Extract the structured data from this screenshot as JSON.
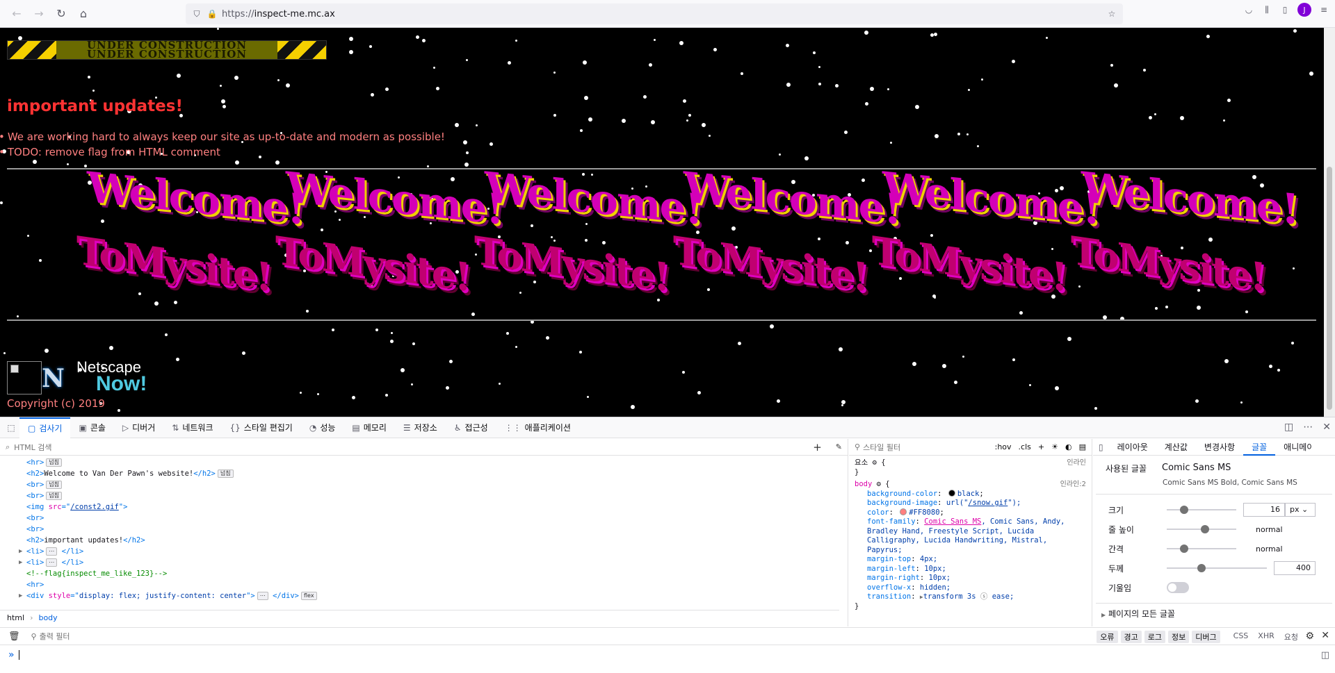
{
  "browser": {
    "url_protocol": "https://",
    "url_host": "inspect-me.mc.ax",
    "avatar_letter": "J"
  },
  "page": {
    "banner_text_1": "UNDER CONSTRUCTION",
    "banner_text_2": "UNDER CONSTRUCTION",
    "heading": "important updates!",
    "updates": [
      "We are working hard to always keep our site as up-to-date and modern as possible!",
      "TODO: remove flag from HTML comment"
    ],
    "welcome_text": "Welcome!",
    "tomysite_text": "ToMysite!",
    "netscape_n": "N",
    "netscape_word1": "Netscape",
    "netscape_word2": "Now!",
    "copyright": "Copyright (c) 2019"
  },
  "devtools": {
    "tabs": [
      {
        "label": "검사기",
        "icon": "inspector-icon"
      },
      {
        "label": "콘솔",
        "icon": "console-icon"
      },
      {
        "label": "디버거",
        "icon": "debugger-icon"
      },
      {
        "label": "네트워크",
        "icon": "network-icon"
      },
      {
        "label": "스타일 편집기",
        "icon": "style-editor-icon"
      },
      {
        "label": "성능",
        "icon": "performance-icon"
      },
      {
        "label": "메모리",
        "icon": "memory-icon"
      },
      {
        "label": "저장소",
        "icon": "storage-icon"
      },
      {
        "label": "접근성",
        "icon": "accessibility-icon"
      },
      {
        "label": "애플리케이션",
        "icon": "application-icon"
      }
    ],
    "html_search_placeholder": "HTML 검색",
    "html_lines": {
      "l1_tag": "<hr>",
      "l1_badge": "넘침",
      "l2_open": "<h2>",
      "l2_text": "Welcome to Van Der Pawn's website!",
      "l2_close": "</h2>",
      "l2_badge": "넘침",
      "l3_tag": "<br>",
      "l3_badge": "넘침",
      "l4_tag": "<br>",
      "l4_badge": "넘침",
      "l5_pre": "<img ",
      "l5_attr": "src",
      "l5_eq": "=\"",
      "l5_val": "/const2.gif",
      "l5_post": "\">",
      "l6_tag": "<br>",
      "l7_tag": "<br>",
      "l8_open": "<h2>",
      "l8_text": "important updates!",
      "l8_close": "</h2>",
      "l9_open": "<li>",
      "l9_dots": "⋯",
      "l9_close": "</li>",
      "l10_open": "<li>",
      "l10_dots": "⋯",
      "l10_close": "</li>",
      "l11_comment": "<!--flag{inspect_me_like_123}-->",
      "l12_tag": "<hr>",
      "l13_pre": "<div ",
      "l13_attr": "style",
      "l13_eq": "=\"",
      "l13_val": "display: flex; justify-content: center",
      "l13_post": "\">",
      "l13_dots": "⋯",
      "l13_close": "</div>",
      "l13_badge": "flex"
    },
    "breadcrumb": [
      "html",
      "body"
    ],
    "rules": {
      "filter_placeholder": "스타일 필터",
      "hov": ":hov",
      "cls": ".cls",
      "element_selector": "요소",
      "inline_label": "인라인",
      "body_selector": "body",
      "body_source": "인라인:2",
      "declarations": [
        {
          "prop": "background-color",
          "val": "black",
          "swatch": "#000000"
        },
        {
          "prop": "background-image",
          "val_pre": "url(\"",
          "val_link": "/snow.gif",
          "val_post": "\");"
        },
        {
          "prop": "color",
          "val": "#FF8080",
          "swatch": "#FF8080"
        },
        {
          "prop": "font-family",
          "val_link": "Comic Sans MS",
          "val": ", Comic Sans, Andy, Bradley Hand, Freestyle Script, Lucida Calligraphy, Lucida Handwriting, Mistral, Papyrus;"
        },
        {
          "prop": "margin-top",
          "val": "4px;"
        },
        {
          "prop": "margin-left",
          "val": "10px;"
        },
        {
          "prop": "margin-right",
          "val": "10px;"
        },
        {
          "prop": "overflow-x",
          "val": "hidden;"
        },
        {
          "prop": "transition",
          "val": "transform 3s",
          "val2": "ease;"
        }
      ]
    },
    "fonts_panel": {
      "tabs": [
        "레이아웃",
        "계산값",
        "변경사항",
        "글꼴",
        "애니메이션"
      ],
      "used_fonts_label": "사용된 글꼴",
      "used_font": "Comic Sans MS",
      "used_font_variants": "Comic Sans MS Bold, Comic Sans MS",
      "size_label": "크기",
      "size_value": "16",
      "size_unit": "px",
      "size_level": 0.25,
      "line_height_label": "줄 높이",
      "line_height_value": "normal",
      "line_height_level": 0.55,
      "spacing_label": "간격",
      "spacing_value": "normal",
      "spacing_level": 0.25,
      "weight_label": "두께",
      "weight_value": "400",
      "weight_level": 0.35,
      "italic_label": "기울임",
      "all_fonts_label": "페이지의 모든 글꼴"
    },
    "console": {
      "filter_placeholder": "출력 필터",
      "filters": [
        "오류",
        "경고",
        "로그",
        "정보",
        "디버그"
      ],
      "extra_filters": [
        "CSS",
        "XHR",
        "요청"
      ],
      "prompt": "»"
    }
  }
}
